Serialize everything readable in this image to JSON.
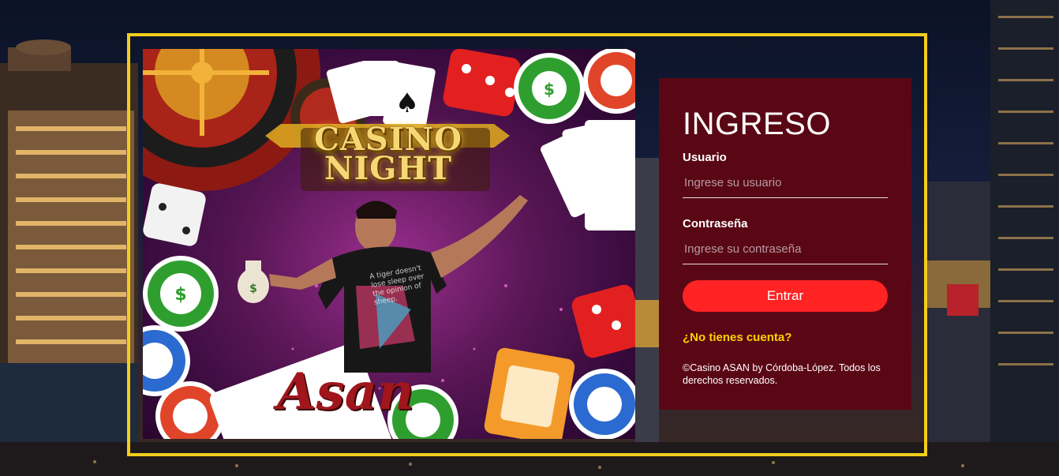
{
  "login": {
    "title": "INGRESO",
    "username_label": "Usuario",
    "username_placeholder": "Ingrese su usuario",
    "username_value": "",
    "password_label": "Contraseña",
    "password_placeholder": "Ingrese su contraseña",
    "password_value": "",
    "submit_label": "Entrar",
    "signup_link": "¿No tienes cuenta?",
    "footer": "©Casino ASAN by Córdoba-López. Todos los derechos reservados."
  },
  "promo": {
    "title_line1": "CASINO",
    "title_line2": "NIGHT",
    "brand": "Asan",
    "shirt_text": "A tiger doesn't lose sleep over the opinion of sheep."
  },
  "colors": {
    "frame": "#f3cd1c",
    "panel": "#5a0715",
    "button": "#ff2323",
    "link": "#ffd200"
  }
}
